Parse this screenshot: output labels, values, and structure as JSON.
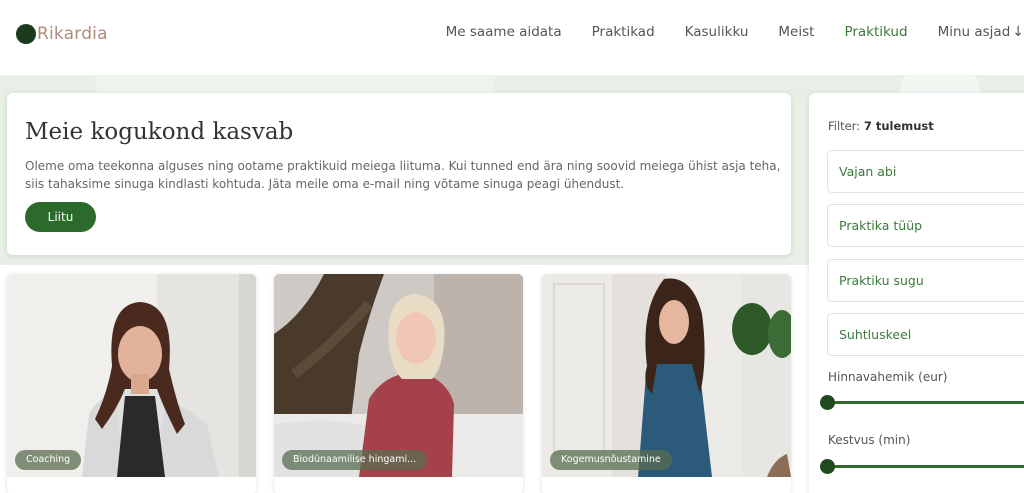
{
  "brand": {
    "name": "Rikardia"
  },
  "nav": {
    "items": [
      "Me saame aidata",
      "Praktikad",
      "Kasulikku",
      "Meist",
      "Praktikud",
      "Minu asjad"
    ],
    "active": "Praktikud",
    "dropdown_arrow": "↓"
  },
  "intro": {
    "title": "Meie kogukond kasvab",
    "text": "Oleme oma teekonna alguses ning ootame praktikuid meiega liituma. Kui tunned end ära ning soovid meiega ühist asja teha, siis tahaksime sinuga kindlasti kohtuda. Jäta meile oma e-mail ning võtame sinuga peagi ühendust.",
    "button": "Liitu"
  },
  "cards": [
    {
      "tag": "Coaching"
    },
    {
      "tag": "Biodünaamilise hingami..."
    },
    {
      "tag": "Kogemusnõustamine"
    }
  ],
  "filter": {
    "label": "Filter:",
    "count": "7 tulemust",
    "selects": [
      "Vajan abi",
      "Praktika tüüp",
      "Praktiku sugu",
      "Suhtluskeel"
    ],
    "ranges": [
      {
        "label": "Hinnavahemik (eur)"
      },
      {
        "label": "Kestvus (min)"
      }
    ]
  },
  "colors": {
    "accent": "#2b6a2b",
    "brand": "#b08c7c",
    "bg_band": "#e8efe7"
  }
}
